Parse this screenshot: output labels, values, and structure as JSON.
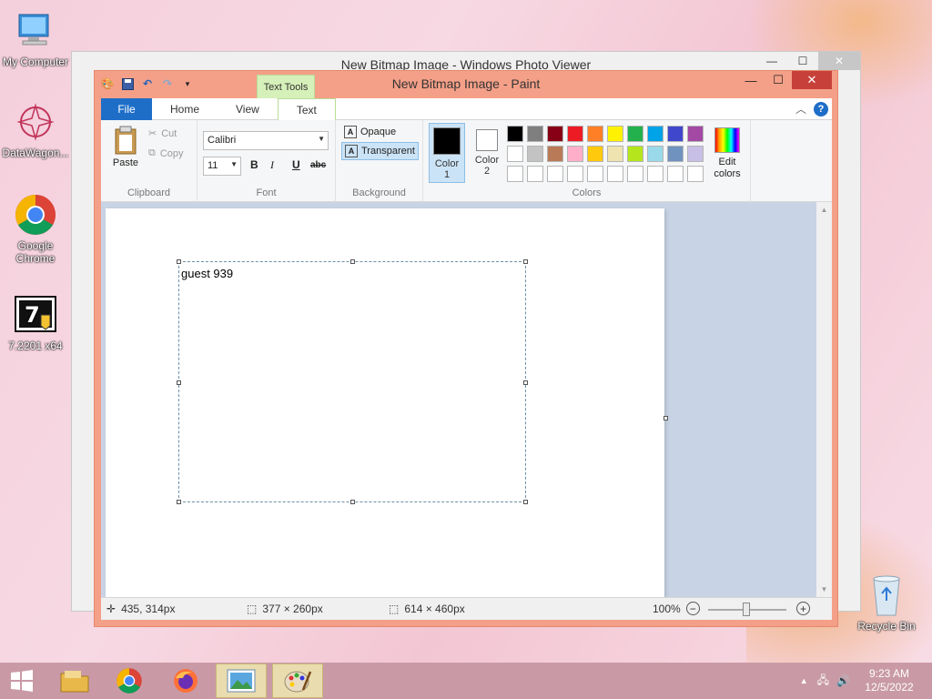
{
  "desktop": {
    "icons": [
      {
        "label": "My Computer"
      },
      {
        "label": "DataWagon..."
      },
      {
        "label": "Google Chrome"
      },
      {
        "label": "7.2201 x64"
      },
      {
        "label": "Recycle Bin"
      }
    ]
  },
  "photo_viewer": {
    "title": "New Bitmap Image - Windows Photo Viewer"
  },
  "paint": {
    "title": "New Bitmap Image - Paint",
    "context_tab": "Text Tools",
    "tabs": [
      "File",
      "Home",
      "View",
      "Text"
    ],
    "clipboard": {
      "paste": "Paste",
      "cut": "Cut",
      "copy": "Copy",
      "label": "Clipboard"
    },
    "font": {
      "name": "Calibri",
      "size": "11",
      "bold": "B",
      "italic": "I",
      "underline": "U",
      "strike": "abc",
      "label": "Font"
    },
    "background": {
      "opaque": "Opaque",
      "transparent": "Transparent",
      "label": "Background"
    },
    "colors": {
      "color1_label": "Color 1",
      "color2_label": "Color 2",
      "color1": "#000000",
      "color2": "#ffffff",
      "edit": "Edit colors",
      "label": "Colors",
      "palette": [
        "#000000",
        "#7f7f7f",
        "#880015",
        "#ed1c24",
        "#ff7f27",
        "#fff200",
        "#22b14c",
        "#00a2e8",
        "#3f48cc",
        "#a349a4",
        "#ffffff",
        "#c3c3c3",
        "#b97a57",
        "#ffaec9",
        "#ffc90e",
        "#efe4b0",
        "#b5e61d",
        "#99d9ea",
        "#7092be",
        "#c8bfe7",
        "#ffffff",
        "#ffffff",
        "#ffffff",
        "#ffffff",
        "#ffffff",
        "#ffffff",
        "#ffffff",
        "#ffffff",
        "#ffffff",
        "#ffffff"
      ]
    },
    "canvas_text": "guest 939",
    "status": {
      "cursor": "435, 314px",
      "selection": "377 × 260px",
      "image_size": "614 × 460px",
      "zoom": "100%"
    }
  },
  "taskbar": {
    "time": "9:23 AM",
    "date": "12/5/2022"
  }
}
